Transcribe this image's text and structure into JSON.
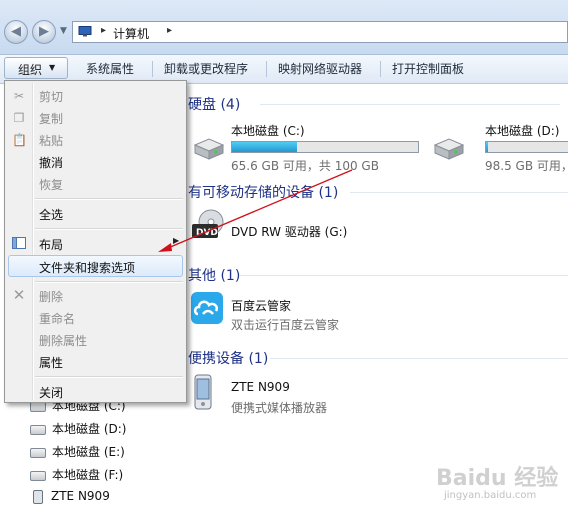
{
  "address_bar": {
    "crumb": "计算机",
    "separator": "▸"
  },
  "toolbar": {
    "organize": "组织",
    "system_properties": "系统属性",
    "uninstall": "卸载或更改程序",
    "map_drive": "映射网络驱动器",
    "open_control_panel": "打开控制面板"
  },
  "groups": {
    "hard_disks": "硬盘 (4)",
    "removable": "有可移动存储的设备 (1)",
    "other": "其他 (1)",
    "portable": "便携设备 (1)"
  },
  "drives": [
    {
      "name": "本地磁盘 (C:)",
      "info": "65.6 GB 可用，共 100 GB",
      "used_fraction": 0.35
    },
    {
      "name": "本地磁盘 (D:)",
      "info": "98.5 GB 可用，",
      "used_fraction": 0.03
    }
  ],
  "dvd": {
    "name": "DVD RW 驱动器 (G:)",
    "icon_label": "DVD"
  },
  "other_item": {
    "name": "百度云管家",
    "sub": "双击运行百度云管家"
  },
  "portable_item": {
    "name": "ZTE N909",
    "sub": "便携式媒体播放器"
  },
  "context_menu": {
    "items": [
      {
        "label": "剪切",
        "enabled": false,
        "icon": "scissors-icon"
      },
      {
        "label": "复制",
        "enabled": false,
        "icon": "copy-icon"
      },
      {
        "label": "粘贴",
        "enabled": false,
        "icon": "paste-icon"
      },
      {
        "label": "撤消",
        "enabled": true
      },
      {
        "label": "恢复",
        "enabled": false
      },
      {
        "label": "全选",
        "enabled": true
      },
      {
        "label": "布局",
        "enabled": true,
        "icon": "layout-icon",
        "submenu": true
      },
      {
        "label": "文件夹和搜索选项",
        "enabled": true,
        "highlighted": true
      },
      {
        "label": "删除",
        "enabled": false,
        "icon": "delete-x-icon"
      },
      {
        "label": "重命名",
        "enabled": false
      },
      {
        "label": "删除属性",
        "enabled": false
      },
      {
        "label": "属性",
        "enabled": true
      },
      {
        "label": "关闭",
        "enabled": true
      }
    ]
  },
  "nav_items": [
    {
      "label": "本地磁盘 (C:)"
    },
    {
      "label": "本地磁盘 (D:)"
    },
    {
      "label": "本地磁盘 (E:)"
    },
    {
      "label": "本地磁盘 (F:)"
    },
    {
      "label": "ZTE N909"
    }
  ],
  "watermark": {
    "line1": "Baidu 经验",
    "line2": "jingyan.baidu.com"
  },
  "colors": {
    "group_heading": "#1e3287",
    "drive_bar_fill": "#2697cf",
    "annotation_arrow": "#d0101a",
    "menu_highlight_border": "#a9c7ea"
  }
}
